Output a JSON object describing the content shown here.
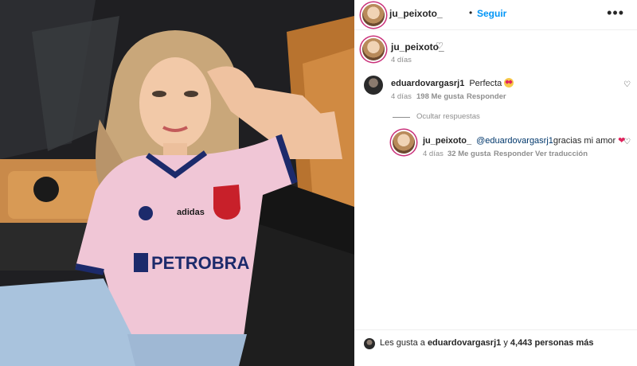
{
  "header": {
    "username": "ju_peixoto_",
    "separator": "•",
    "follow_label": "Seguir",
    "more_icon": "more-horizontal-icon"
  },
  "caption": {
    "username": "ju_peixoto_",
    "time": "4 días"
  },
  "comments": [
    {
      "username": "eduardovargasrj1",
      "text": "Perfecta",
      "emoji": "heart-eyes-emoji",
      "time": "4 días",
      "likes": "198 Me gusta",
      "reply_label": "Responder"
    }
  ],
  "hide_replies_label": "Ocultar respuestas",
  "reply": {
    "username": "ju_peixoto_",
    "mention": "@eduardovargasrj1",
    "text": "gracias mi amor",
    "emoji": "❤",
    "time": "4 días",
    "likes": "32 Me gusta",
    "reply_label": "Responder",
    "translate_label": "Ver traducción"
  },
  "footer": {
    "prefix": "Les gusta a",
    "liker": "eduardovargasrj1",
    "joiner": "y",
    "others": "4,443 personas más"
  },
  "photo": {
    "jersey_sponsor": "PETROBRA",
    "jersey_crest": "U",
    "jersey_brand": "adidas"
  }
}
